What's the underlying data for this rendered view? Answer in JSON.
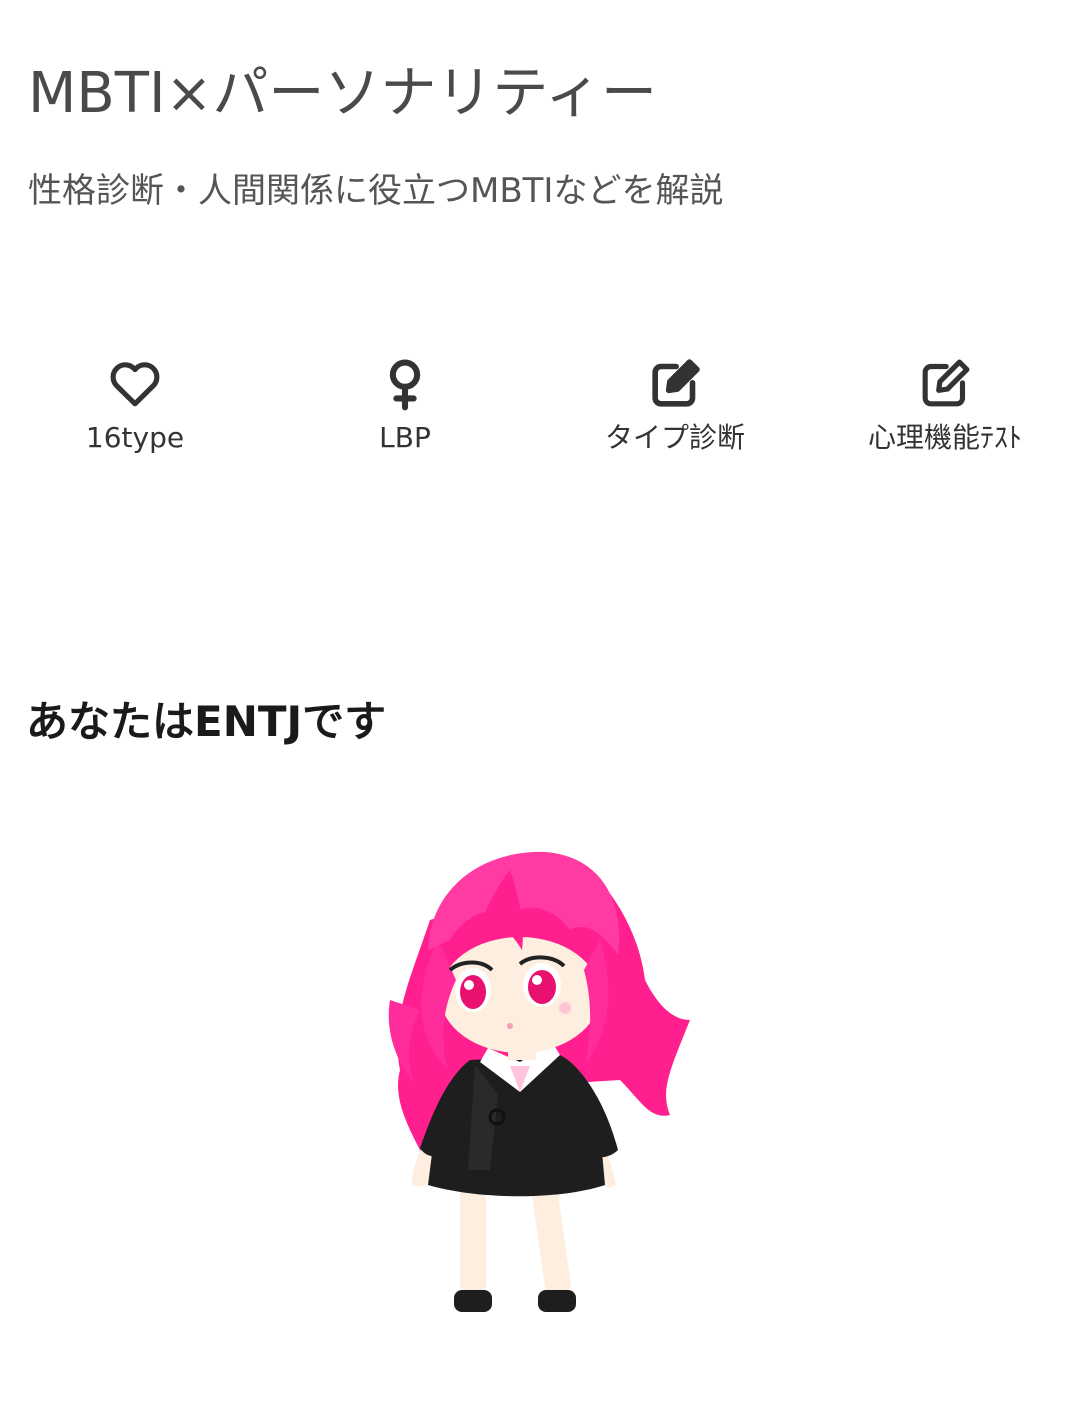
{
  "site": {
    "title": "MBTI×パーソナリティー",
    "tagline": "性格診断・人間関係に役立つMBTIなどを解説"
  },
  "nav": {
    "items": [
      {
        "label": "16type",
        "icon": "heart-icon"
      },
      {
        "label": "LBP",
        "icon": "female-symbol-icon"
      },
      {
        "label": "タイプ診断",
        "icon": "edit-square-filled-icon"
      },
      {
        "label": "心理機能ﾃｽﾄ",
        "icon": "edit-square-outline-icon"
      }
    ]
  },
  "result": {
    "heading": "あなたはENTJです",
    "character_image": "entj-character-illustration"
  },
  "colors": {
    "text_primary": "#333333",
    "hair_pink": "#ff2d9b",
    "suit_black": "#1e1e1e"
  }
}
